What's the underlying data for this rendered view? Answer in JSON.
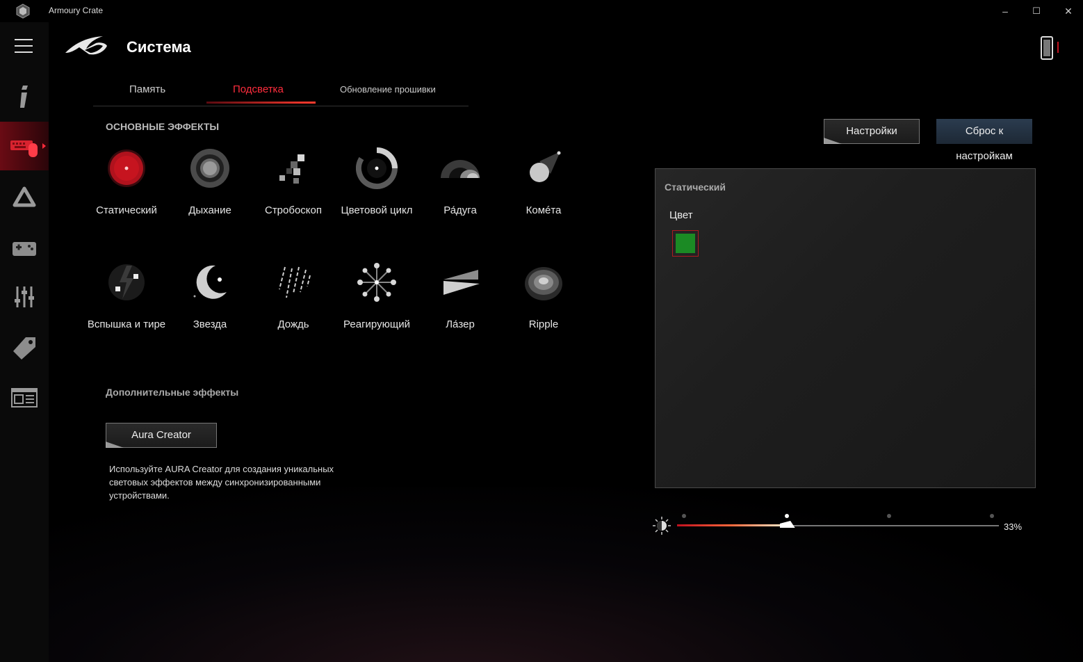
{
  "app": {
    "title": "Armoury Crate",
    "logo_icon": "armoury-crate-logo"
  },
  "window_controls": {
    "minimize": "–",
    "maximize": "☐",
    "close": "✕"
  },
  "sidebar": {
    "items": [
      {
        "name": "device-info",
        "icon": "info-icon"
      },
      {
        "name": "devices",
        "icon": "keyboard-mouse-icon",
        "active": true
      },
      {
        "name": "aura-sync",
        "icon": "triangle-icon"
      },
      {
        "name": "game-library",
        "icon": "gamepad-icon"
      },
      {
        "name": "scenario-profiles",
        "icon": "sliders-icon"
      },
      {
        "name": "deals",
        "icon": "tag-icon"
      },
      {
        "name": "news",
        "icon": "news-icon"
      }
    ]
  },
  "header": {
    "title": "Система"
  },
  "tabs": [
    {
      "label": "Память"
    },
    {
      "label": "Подсветка",
      "active": true
    },
    {
      "label": "Обновление прошивки"
    }
  ],
  "main_effects": {
    "title": "ОСНОВНЫЕ ЭФФЕКТЫ",
    "items": [
      {
        "label": "Статический",
        "icon": "static-icon"
      },
      {
        "label": "Дыхание",
        "icon": "breathing-icon"
      },
      {
        "label": "Стробоскоп",
        "icon": "strobe-icon"
      },
      {
        "label": "Цветовой цикл",
        "icon": "color-cycle-icon"
      },
      {
        "label": "Ра́дуга",
        "icon": "rainbow-icon"
      },
      {
        "label": "Комéта",
        "icon": "comet-icon"
      },
      {
        "label": "Вспышка и тире",
        "icon": "flash-dash-icon"
      },
      {
        "label": "Звезда",
        "icon": "star-icon"
      },
      {
        "label": "Дождь",
        "icon": "rain-icon"
      },
      {
        "label": "Реагирующий",
        "icon": "reactive-icon"
      },
      {
        "label": "Ла́зер",
        "icon": "laser-icon"
      },
      {
        "label": "Ripple",
        "icon": "ripple-icon"
      }
    ]
  },
  "extra_effects": {
    "title": "Дополнительные эффекты",
    "button": "Aura Creator",
    "description": "Используйте AURA Creator для создания уникальных световых эффектов между синхронизированными устройствами."
  },
  "actions": {
    "settings": "Настройки",
    "reset": "Сброс к настройкам"
  },
  "effect_panel": {
    "title": "Статический",
    "color_label": "Цвет",
    "color_value": "#1b8a24"
  },
  "brightness": {
    "value_text": "33%",
    "level": 0.33,
    "steps": 4,
    "active_step": 1
  }
}
